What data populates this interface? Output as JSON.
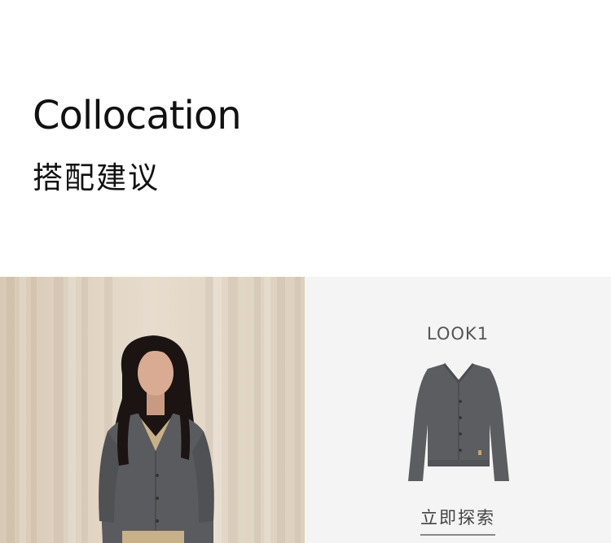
{
  "header": {
    "title_en": "Collocation",
    "title_cn": "搭配建议"
  },
  "look": {
    "label": "LOOK1",
    "explore_label": "立即探索"
  },
  "colors": {
    "curtain": "#e3d6c4",
    "panel_bg": "#f4f4f4",
    "cardigan": "#595b5e",
    "hair": "#1b1412"
  },
  "icons": {
    "model_photo": "model-photo",
    "product": "cardigan-product-image"
  }
}
